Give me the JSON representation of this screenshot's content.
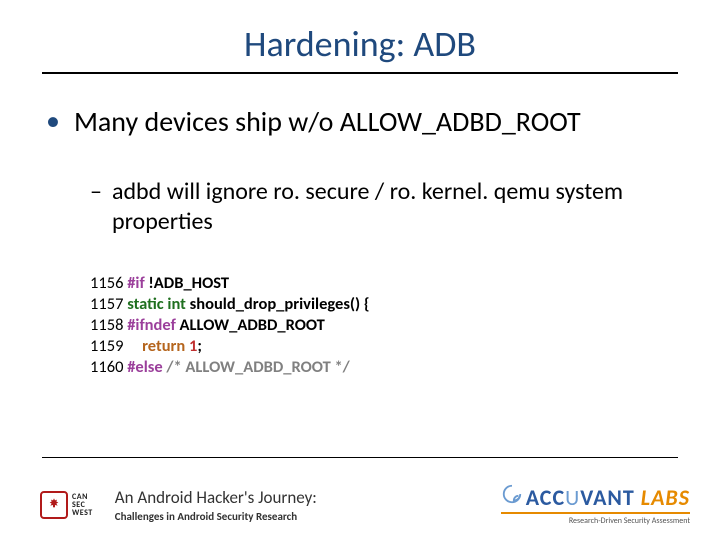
{
  "title": "Hardening: ADB",
  "bullet_l1": "Many devices ship w/o ALLOW_ADBD_ROOT",
  "bullet_l2": "adbd will ignore ro. secure / ro. kernel. qemu system properties",
  "code": {
    "l1": {
      "num": "1156 ",
      "pre": "#if ",
      "rest": "!ADB_HOST"
    },
    "l2": {
      "num": "1157 ",
      "kw": "static int ",
      "rest": "should_drop_privileges() {"
    },
    "l3": {
      "num": "1158 ",
      "pre": "#ifndef ",
      "rest": "ALLOW_ADBD_ROOT"
    },
    "l4": {
      "num": "1159     ",
      "ret": "return ",
      "val": "1",
      "semi": ";"
    },
    "l5": {
      "num": "1160 ",
      "pre": "#else ",
      "cmt": "/* ALLOW_ADBD_ROOT */"
    }
  },
  "footer": {
    "conf_lines": [
      "CAN",
      "SEC",
      "WEST"
    ],
    "title": "An Android Hacker's Journey:",
    "subtitle": "Challenges in Android Security Research",
    "accuvant": "ACCUVANT",
    "labs": "LABS",
    "tagline": "Research-Driven Security Assessment"
  }
}
